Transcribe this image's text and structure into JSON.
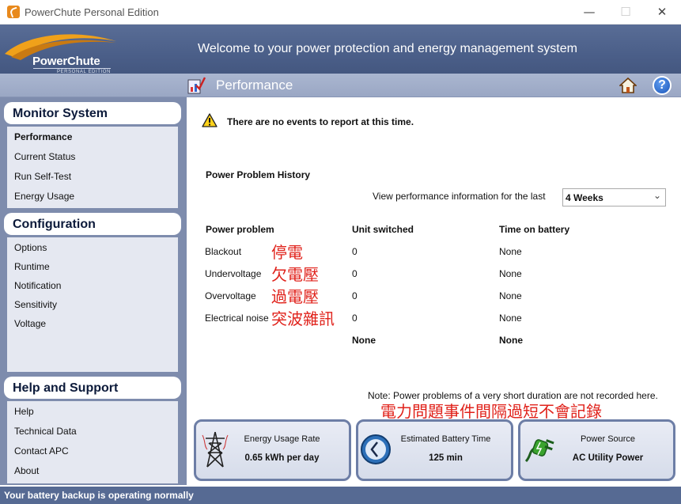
{
  "window": {
    "title": "PowerChute Personal Edition"
  },
  "header": {
    "logo_brand": "PowerChute",
    "logo_sub": "PERSONAL EDITION",
    "welcome": "Welcome to your power protection and energy management system"
  },
  "page": {
    "title": "Performance"
  },
  "sidebar": {
    "monitor": {
      "heading": "Monitor System",
      "items": [
        "Performance",
        "Current Status",
        "Run Self-Test",
        "Energy Usage"
      ]
    },
    "config": {
      "heading": "Configuration",
      "items": [
        "Options",
        "Runtime",
        "Notification",
        "Sensitivity",
        "Voltage"
      ]
    },
    "help": {
      "heading": "Help and Support",
      "items": [
        "Help",
        "Technical Data",
        "Contact APC",
        "About"
      ]
    }
  },
  "content": {
    "no_events": "There are no events to report at this time.",
    "history_title": "Power Problem History",
    "view_label": "View performance information for the last",
    "period_selected": "4 Weeks",
    "columns": [
      "Power problem",
      "Unit switched",
      "Time on battery"
    ],
    "rows": [
      {
        "problem": "Blackout",
        "annotation": "停電",
        "switched": "0",
        "battery": "None"
      },
      {
        "problem": "Undervoltage",
        "annotation": "欠電壓",
        "switched": "0",
        "battery": "None"
      },
      {
        "problem": "Overvoltage",
        "annotation": "過電壓",
        "switched": "0",
        "battery": "None"
      },
      {
        "problem": "Electrical noise",
        "annotation": "突波雜訊",
        "switched": "0",
        "battery": "None"
      }
    ],
    "totals": {
      "switched": "None",
      "battery": "None"
    },
    "note": "Note: Power problems of a very short duration are not recorded here.",
    "note_annotation": "電力問題事件間隔過短不會記錄"
  },
  "cards": [
    {
      "label": "Energy Usage Rate",
      "value": "0.65 kWh per day",
      "icon": "power-tower-icon"
    },
    {
      "label": "Estimated Battery Time",
      "value": "125 min",
      "icon": "clock-icon"
    },
    {
      "label": "Power Source",
      "value": "AC Utility Power",
      "icon": "plug-icon"
    }
  ],
  "status": {
    "text": "Your battery backup is operating normally"
  }
}
